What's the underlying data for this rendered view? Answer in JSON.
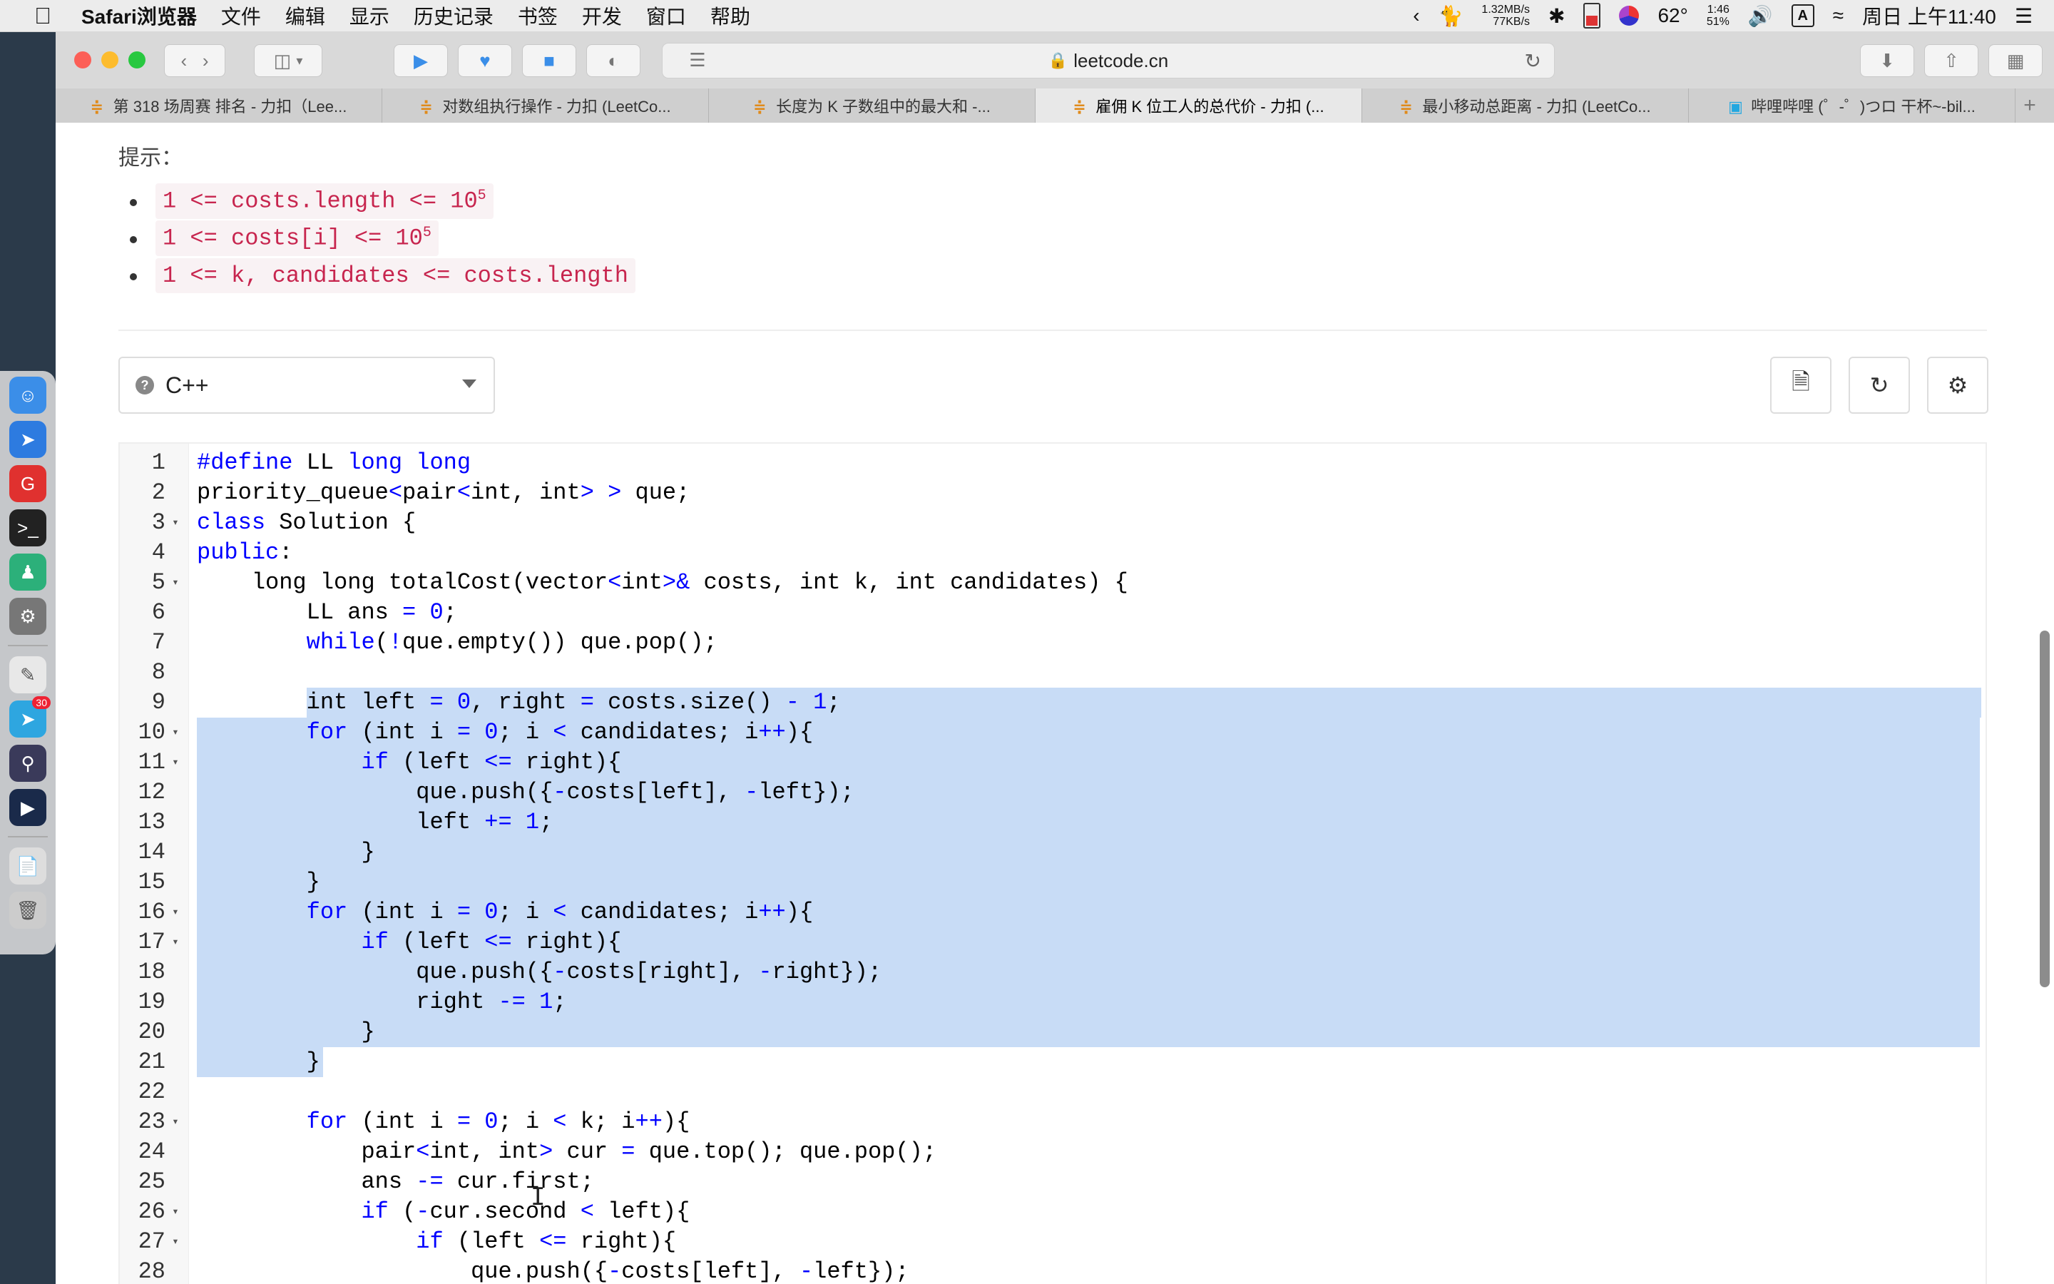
{
  "menubar": {
    "app": "Safari浏览器",
    "items": [
      "文件",
      "编辑",
      "显示",
      "历史记录",
      "书签",
      "开发",
      "窗口",
      "帮助"
    ],
    "net_up": "1.32MB/s",
    "net_down": "77KB/s",
    "temp": "62°",
    "battery_time": "1:46",
    "battery_pct": "51%",
    "input": "A",
    "clock": "周日 上午11:40"
  },
  "browser": {
    "url": "leetcode.cn",
    "tabs": [
      {
        "label": "第 318 场周赛 排名 - 力扣（Lee...",
        "active": false
      },
      {
        "label": "对数组执行操作 - 力扣 (LeetCo...",
        "active": false
      },
      {
        "label": "长度为 K 子数组中的最大和 -...",
        "active": false
      },
      {
        "label": "雇佣 K 位工人的总代价 - 力扣 (...",
        "active": true
      },
      {
        "label": "最小移动总距离 - 力扣 (LeetCo...",
        "active": false
      },
      {
        "label": "哔哩哔哩 (゜-゜)つロ 干杯~-bil...",
        "active": false
      }
    ]
  },
  "problem": {
    "hint_title": "提示：",
    "constraints": [
      {
        "text": "1 <= costs.length <= 10",
        "sup": "5"
      },
      {
        "text": "1 <= costs[i] <= 10",
        "sup": "5"
      },
      {
        "text": "1 <= k, candidates <= costs.length",
        "sup": ""
      }
    ]
  },
  "editor": {
    "language": "C++",
    "lines": [
      "#define LL long long",
      "priority_queue<pair<int, int> > que;",
      "class Solution {",
      "public:",
      "    long long totalCost(vector<int>& costs, int k, int candidates) {",
      "        LL ans = 0;",
      "        while(!que.empty()) que.pop();",
      "",
      "        int left = 0, right = costs.size() - 1;",
      "        for (int i = 0; i < candidates; i++){",
      "            if (left <= right){",
      "                que.push({-costs[left], -left});",
      "                left += 1;",
      "            }",
      "        }",
      "        for (int i = 0; i < candidates; i++){",
      "            if (left <= right){",
      "                que.push({-costs[right], -right});",
      "                right -= 1;",
      "            }",
      "        }",
      "",
      "        for (int i = 0; i < k; i++){",
      "            pair<int, int> cur = que.top(); que.pop();",
      "            ans -= cur.first;",
      "            if (-cur.second < left){",
      "                if (left <= right){",
      "                    que.push({-costs[left], -left});"
    ],
    "fold_lines": [
      3,
      5,
      10,
      11,
      16,
      17,
      23,
      26,
      27
    ],
    "selection_start": 9,
    "selection_end": 21
  },
  "colors": {
    "selection": "#c8dcf6",
    "keyword": "#0000ff",
    "hint_code": "#c7254e"
  }
}
